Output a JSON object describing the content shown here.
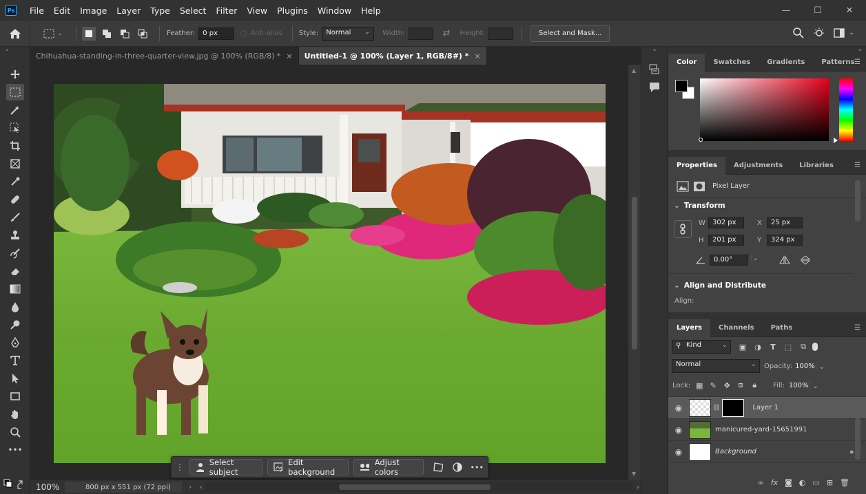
{
  "app": {
    "logo": "Ps"
  },
  "menu": [
    "File",
    "Edit",
    "Image",
    "Layer",
    "Type",
    "Select",
    "Filter",
    "View",
    "Plugins",
    "Window",
    "Help"
  ],
  "window_controls": {
    "minimize": "—",
    "maximize": "☐",
    "close": "✕"
  },
  "options": {
    "feather_label": "Feather:",
    "feather_value": "0 px",
    "antialias_label": "Anti-alias",
    "style_label": "Style:",
    "style_value": "Normal",
    "width_label": "Width:",
    "height_label": "Height:",
    "select_mask_label": "Select and Mask..."
  },
  "tabs": [
    {
      "label": "Chihuahua-standing-in-three-quarter-view.jpg @ 100% (RGB/8) *",
      "close": "×"
    },
    {
      "label": "Untitled-1 @ 100% (Layer 1, RGB/8#) *",
      "close": "×"
    }
  ],
  "context_bar": {
    "select_subject": "Select subject",
    "edit_background": "Edit background",
    "adjust_colors": "Adjust colors",
    "more": "•••"
  },
  "status": {
    "zoom": "100%",
    "doc_size": "800 px x 551 px (72 ppi)"
  },
  "color_panel": {
    "tabs": [
      "Color",
      "Swatches",
      "Gradients",
      "Patterns"
    ],
    "foreground": "#000000",
    "background": "#ffffff",
    "hue_color": "#ff0000"
  },
  "properties_panel": {
    "tabs": [
      "Properties",
      "Adjustments",
      "Libraries"
    ],
    "pixel_layer_label": "Pixel Layer",
    "transform_label": "Transform",
    "w_label": "W",
    "w_value": "302 px",
    "h_label": "H",
    "h_value": "201 px",
    "x_label": "X",
    "x_value": "25 px",
    "y_label": "Y",
    "y_value": "324 px",
    "angle_value": "0.00°",
    "align_label": "Align and Distribute",
    "align_sub": "Align:"
  },
  "layers_panel": {
    "tabs": [
      "Layers",
      "Channels",
      "Paths"
    ],
    "filter_value": "Kind",
    "blend_value": "Normal",
    "opacity_label": "Opacity:",
    "opacity_value": "100%",
    "lock_label": "Lock:",
    "fill_label": "Fill:",
    "fill_value": "100%",
    "layers": [
      {
        "name": "Layer 1"
      },
      {
        "name": "manicured-yard-15651991"
      },
      {
        "name": "Background"
      }
    ]
  },
  "bottom_icons": [
    "link",
    "fx",
    "mask",
    "adjustment",
    "group",
    "new",
    "trash"
  ]
}
